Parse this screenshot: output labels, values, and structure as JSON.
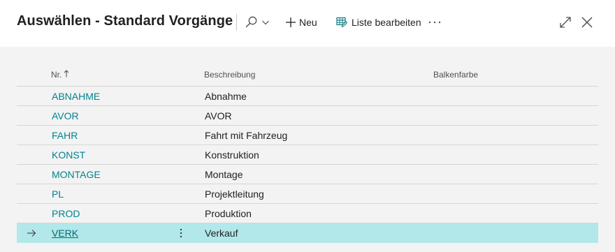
{
  "header": {
    "title": "Auswählen - Standard Vorgänge",
    "new_label": "Neu",
    "edit_list_label": "Liste bearbeiten"
  },
  "icons": {
    "search": "search-icon",
    "chevron": "chevron-down-icon",
    "add": "plus-icon",
    "edit_list": "edit-list-icon",
    "more": "more-icon",
    "expand": "expand-icon",
    "close": "close-icon",
    "sort": "sort-ascending-icon",
    "current_row": "arrow-right-icon",
    "row_actions": "vertical-ellipsis-icon"
  },
  "colors": {
    "accent": "#00838f",
    "selected_row": "#b2e8ea",
    "edit_icon": "#0e7a82"
  },
  "grid": {
    "columns": {
      "nr": "Nr.",
      "description": "Beschreibung",
      "bar_color": "Balkenfarbe"
    },
    "rows": [
      {
        "nr": "ABNAHME",
        "description": "Abnahme",
        "bar_color": ""
      },
      {
        "nr": "AVOR",
        "description": "AVOR",
        "bar_color": ""
      },
      {
        "nr": "FAHR",
        "description": "Fahrt mit Fahrzeug",
        "bar_color": ""
      },
      {
        "nr": "KONST",
        "description": "Konstruktion",
        "bar_color": ""
      },
      {
        "nr": "MONTAGE",
        "description": "Montage",
        "bar_color": ""
      },
      {
        "nr": "PL",
        "description": "Projektleitung",
        "bar_color": ""
      },
      {
        "nr": "PROD",
        "description": "Produktion",
        "bar_color": ""
      },
      {
        "nr": "VERK",
        "description": "Verkauf",
        "bar_color": "",
        "selected": true
      }
    ]
  }
}
